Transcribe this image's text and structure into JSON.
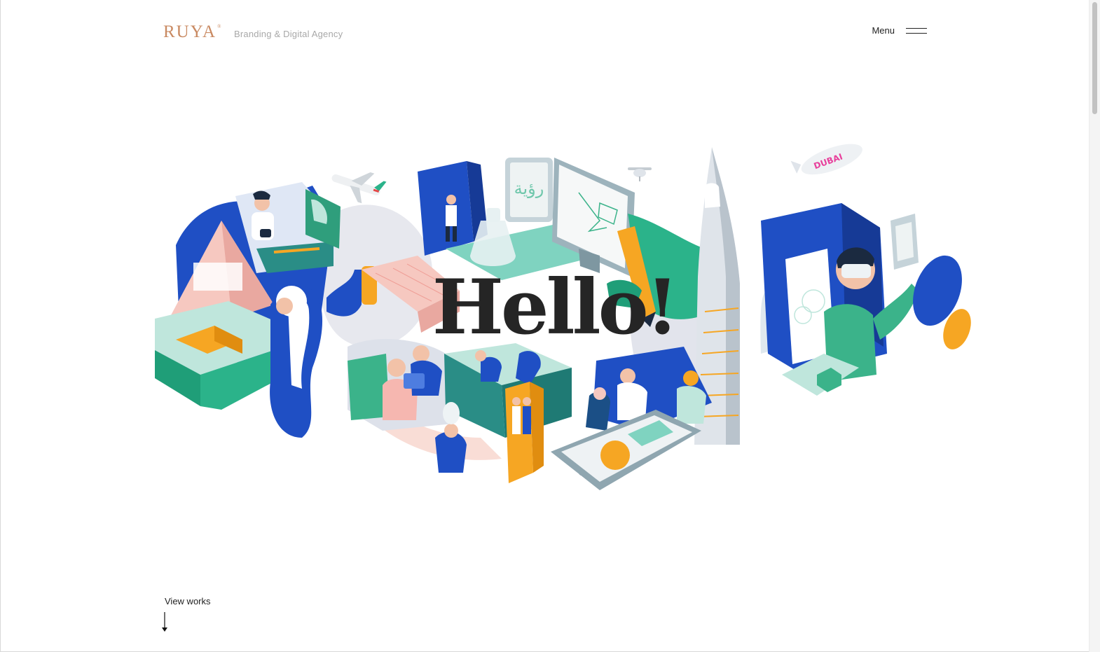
{
  "header": {
    "logo_text": "RUYA",
    "logo_mark": "®",
    "tagline": "Branding & Digital Agency",
    "menu_label": "Menu"
  },
  "hero": {
    "headline": "Hello!",
    "sign_text": "رؤية",
    "blimp_text": "DUBAI"
  },
  "footer": {
    "view_works_label": "View works"
  },
  "icons": {
    "menu": "hamburger-icon",
    "scroll": "arrow-down-icon"
  },
  "colors": {
    "brand_copper": "#c98a62",
    "royal_blue": "#1f4fc4",
    "teal_green": "#3bb38a",
    "mint": "#bfe6dc",
    "blush_pink": "#f6c8c0",
    "amber": "#f6a623",
    "headline": "#252525"
  }
}
